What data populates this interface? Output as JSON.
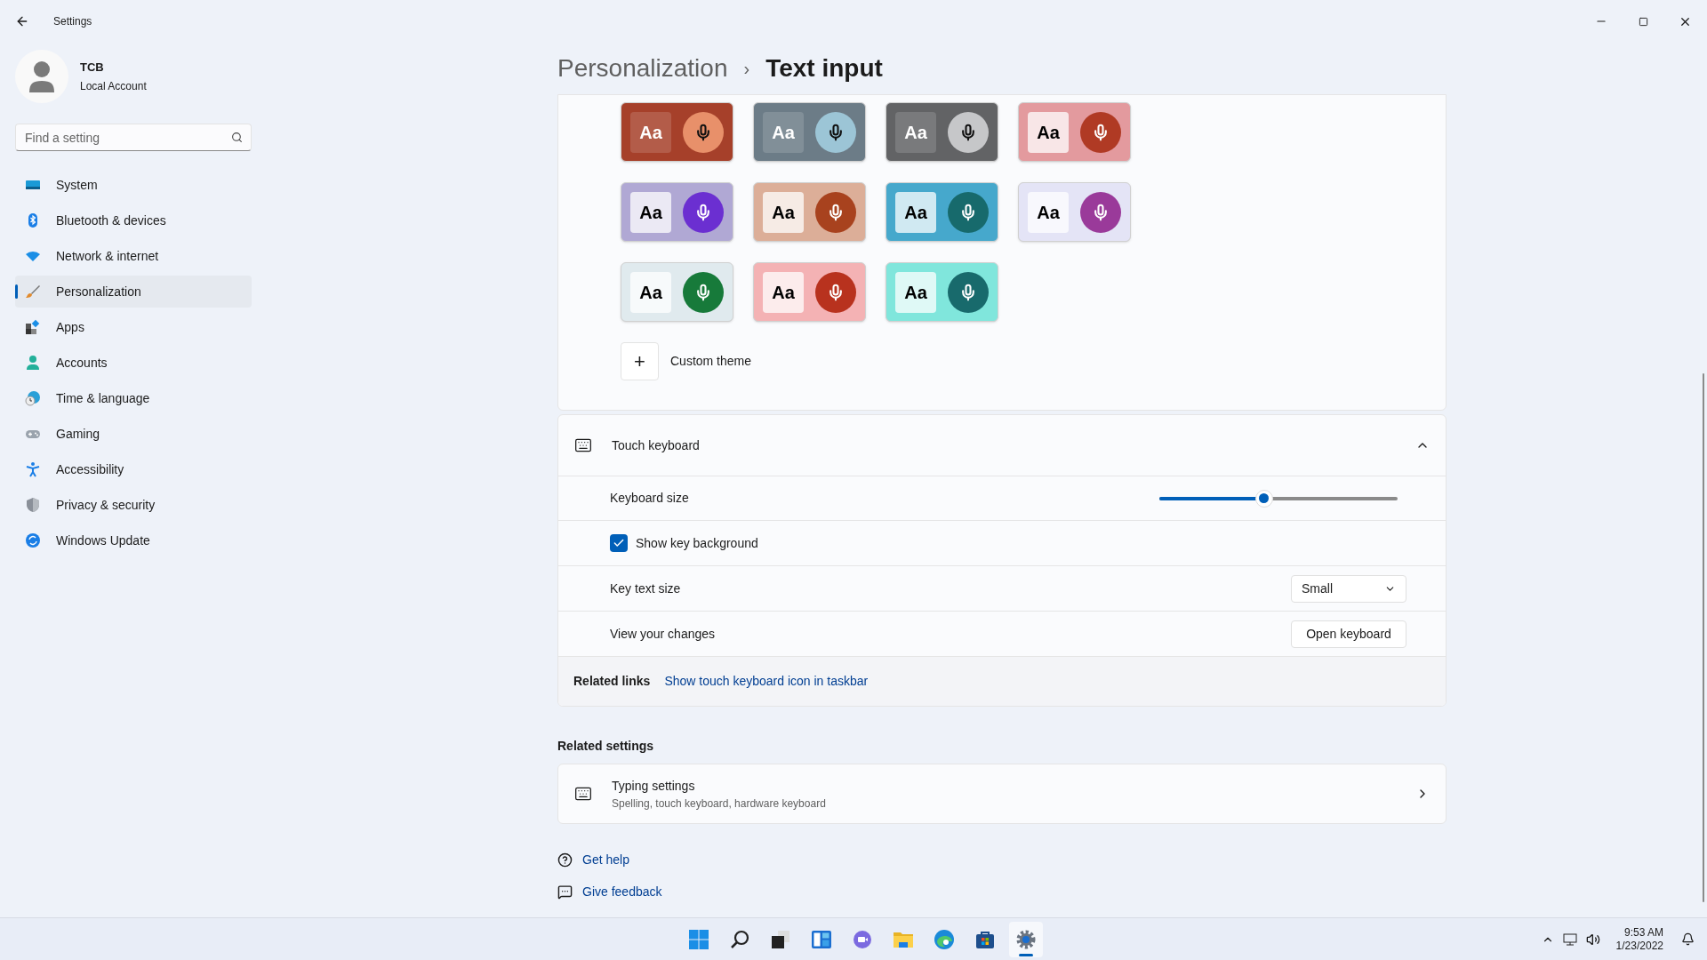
{
  "window": {
    "title": "Settings"
  },
  "account": {
    "name": "TCB",
    "type": "Local Account"
  },
  "search": {
    "placeholder": "Find a setting"
  },
  "sidebar": {
    "items": [
      {
        "label": "System",
        "kind": "system",
        "selected": false
      },
      {
        "label": "Bluetooth & devices",
        "kind": "bluetooth",
        "selected": false
      },
      {
        "label": "Network & internet",
        "kind": "network",
        "selected": false
      },
      {
        "label": "Personalization",
        "kind": "personalization",
        "selected": true
      },
      {
        "label": "Apps",
        "kind": "apps",
        "selected": false
      },
      {
        "label": "Accounts",
        "kind": "accounts",
        "selected": false
      },
      {
        "label": "Time & language",
        "kind": "time",
        "selected": false
      },
      {
        "label": "Gaming",
        "kind": "gaming",
        "selected": false
      },
      {
        "label": "Accessibility",
        "kind": "accessibility",
        "selected": false
      },
      {
        "label": "Privacy & security",
        "kind": "privacy",
        "selected": false
      },
      {
        "label": "Windows Update",
        "kind": "update",
        "selected": false
      }
    ]
  },
  "breadcrumb": {
    "parent": "Personalization",
    "separator": "›",
    "current": "Text input"
  },
  "themes": [
    {
      "sample": "Aa",
      "dark": true,
      "color": "#a6402a",
      "accent": {
        "color": "#e8906a"
      }
    },
    {
      "sample": "Aa",
      "dark": true,
      "color": "#6c7c87",
      "accent": {
        "color": "#9cc5d6"
      }
    },
    {
      "sample": "Aa",
      "dark": true,
      "color": "#626365",
      "accent": {
        "color": "#c6c7c9"
      }
    },
    {
      "sample": "Aa",
      "dark": false,
      "color": "#e39a9e",
      "accent": {
        "color": "#b03a24"
      }
    },
    {
      "sample": "Aa",
      "dark": false,
      "color": "#b0a8d4",
      "accent": {
        "color": "#6b2fd1"
      }
    },
    {
      "sample": "Aa",
      "dark": false,
      "color": "#dcae98",
      "accent": {
        "color": "#a8421e"
      }
    },
    {
      "sample": "Aa",
      "dark": false,
      "color": "#46a8cc",
      "accent": {
        "color": "#176a6c"
      }
    },
    {
      "sample": "Aa",
      "dark": false,
      "color": "#e4e4f6",
      "accent": {
        "color": "#9a3a9a"
      }
    },
    {
      "sample": "Aa",
      "dark": false,
      "color": "#e0eaee",
      "accent": {
        "color": "#177a3a"
      }
    },
    {
      "sample": "Aa",
      "dark": false,
      "color": "#f4b2b4",
      "accent": {
        "color": "#b8321e"
      }
    },
    {
      "sample": "Aa",
      "dark": false,
      "color": "#80e6dc",
      "accent": {
        "color": "#186a6c"
      }
    }
  ],
  "custom_theme": {
    "icon": "+",
    "label": "Custom theme"
  },
  "touch_keyboard": {
    "title": "Touch keyboard",
    "expanded": true,
    "keyboard_size": {
      "label": "Keyboard size",
      "level": 0.44
    },
    "show_key_background": {
      "label": "Show key background",
      "checked": true
    },
    "key_text_size": {
      "label": "Key text size",
      "value": "Small"
    },
    "view_changes": {
      "label": "View your changes",
      "button": "Open keyboard"
    },
    "related_links": {
      "label": "Related links",
      "link": "Show touch keyboard icon in taskbar"
    }
  },
  "related_settings": {
    "heading": "Related settings",
    "items": [
      {
        "title": "Typing settings",
        "subtitle": "Spelling, touch keyboard, hardware keyboard"
      }
    ]
  },
  "help_links": [
    {
      "kind": "help",
      "label": "Get help"
    },
    {
      "kind": "feedback",
      "label": "Give feedback"
    }
  ],
  "taskbar": {
    "apps": [
      {
        "kind": "start",
        "selected": false
      },
      {
        "kind": "search",
        "selected": false
      },
      {
        "kind": "taskview",
        "selected": false
      },
      {
        "kind": "widgets",
        "selected": false
      },
      {
        "kind": "chat",
        "selected": false
      },
      {
        "kind": "explorer",
        "selected": false
      },
      {
        "kind": "edge",
        "selected": false
      },
      {
        "kind": "store",
        "selected": false
      },
      {
        "kind": "settings",
        "selected": true
      }
    ],
    "time": "9:53 AM",
    "date": "1/23/2022"
  }
}
